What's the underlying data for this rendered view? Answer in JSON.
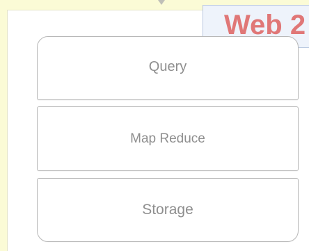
{
  "title": "Web 2",
  "layers": [
    {
      "label": "Query"
    },
    {
      "label": "Map Reduce"
    },
    {
      "label": "Storage"
    }
  ],
  "colors": {
    "background": "#fbfbd6",
    "title_text": "#e07777",
    "title_box": "#eef3fb",
    "layer_border": "#b8b8b8",
    "layer_text": "#8e8e8e"
  }
}
